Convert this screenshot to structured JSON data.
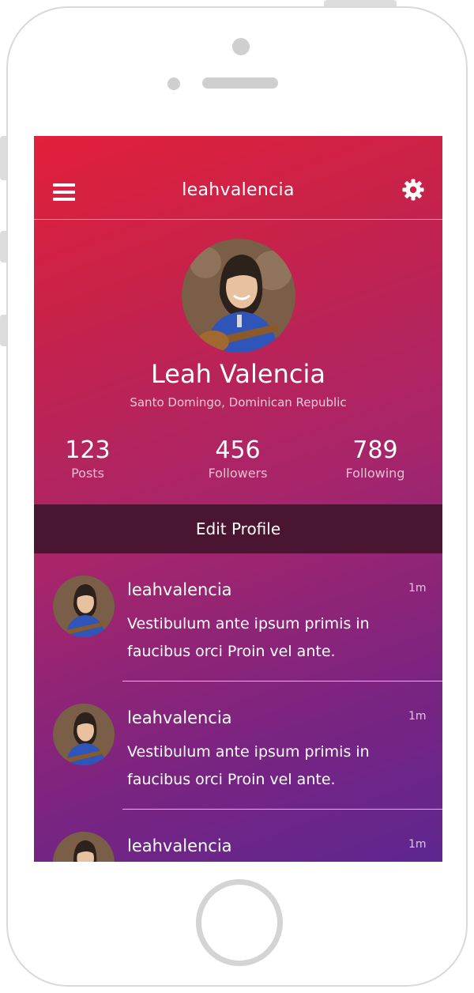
{
  "header": {
    "title": "leahvalencia",
    "menu_icon": "hamburger-menu-icon",
    "settings_icon": "gear-icon"
  },
  "profile": {
    "name": "Leah Valencia",
    "location": "Santo Domingo, Dominican Republic",
    "avatar_icon": "profile-photo"
  },
  "stats": [
    {
      "value": "123",
      "label": "Posts"
    },
    {
      "value": "456",
      "label": "Followers"
    },
    {
      "value": "789",
      "label": "Following"
    }
  ],
  "edit_button": {
    "label": "Edit Profile"
  },
  "posts": [
    {
      "user": "leahvalencia",
      "time": "1m",
      "text": "Vestibulum ante ipsum primis in faucibus orci Proin vel ante."
    },
    {
      "user": "leahvalencia",
      "time": "1m",
      "text": "Vestibulum ante ipsum primis in faucibus orci Proin vel ante."
    },
    {
      "user": "leahvalencia",
      "time": "1m",
      "text": ""
    }
  ],
  "colors": {
    "gradient_start": "#e2203a",
    "gradient_end": "#5e2690",
    "edit_button_bg": "#4a1531"
  }
}
